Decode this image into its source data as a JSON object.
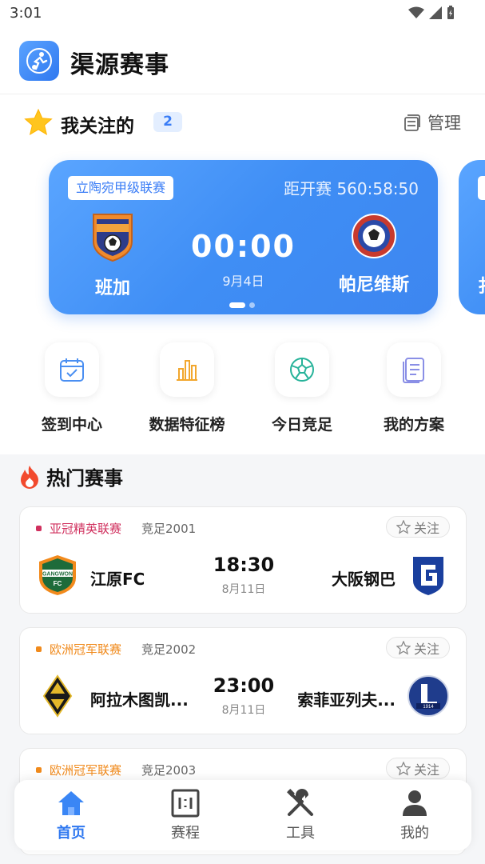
{
  "status_bar": {
    "time": "3:01"
  },
  "app": {
    "title": "渠源赛事"
  },
  "follow": {
    "title": "我关注的",
    "count": "2",
    "manage_label": "管理",
    "card": {
      "league": "立陶宛甲级联赛",
      "countdown": "距开赛 560:58:50",
      "home_team": "班加",
      "away_team": "帕尼维斯",
      "time": "00:00",
      "date": "9月4日",
      "next_card_team_initial": "扌"
    }
  },
  "quick_links": [
    {
      "label": "签到中心",
      "icon": "calendar-check-icon"
    },
    {
      "label": "数据特征榜",
      "icon": "bar-chart-icon"
    },
    {
      "label": "今日竞足",
      "icon": "soccer-ball-icon"
    },
    {
      "label": "我的方案",
      "icon": "document-icon"
    }
  ],
  "hot": {
    "title": "热门赛事",
    "follow_label": "关注",
    "matches": [
      {
        "league": "亚冠精英联赛",
        "league_color": "#d0305e",
        "code": "竞足2001",
        "home": "江原FC",
        "away": "大阪钢巴",
        "time": "18:30",
        "date": "8月11日"
      },
      {
        "league": "欧洲冠军联赛",
        "league_color": "#f08a1c",
        "code": "竞足2002",
        "home": "阿拉木图凯...",
        "away": "索菲亚列夫...",
        "time": "23:00",
        "date": "8月11日"
      },
      {
        "league": "欧洲冠军联赛",
        "league_color": "#f08a1c",
        "code": "竞足2003",
        "home": "",
        "away": "",
        "time": "",
        "date": ""
      }
    ]
  },
  "tabs": [
    {
      "label": "首页",
      "icon": "home-icon",
      "active": true
    },
    {
      "label": "赛程",
      "icon": "schedule-icon",
      "active": false
    },
    {
      "label": "工具",
      "icon": "tools-icon",
      "active": false
    },
    {
      "label": "我的",
      "icon": "user-icon",
      "active": false
    }
  ],
  "colors": {
    "accent": "#2f78f0",
    "card_gradient_start": "#5aa5ff",
    "card_gradient_end": "#3d86f0"
  }
}
